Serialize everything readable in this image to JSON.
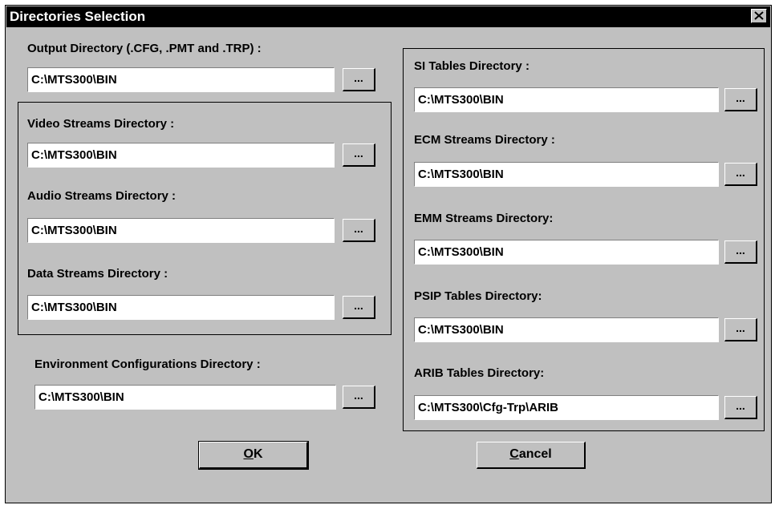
{
  "window": {
    "title": "Directories Selection",
    "close_glyph": "x-icon"
  },
  "browse_label": "...",
  "output": {
    "label": "Output Directory (.CFG, .PMT and .TRP) :",
    "value": "C:\\MTS300\\BIN"
  },
  "video": {
    "label": "Video Streams Directory :",
    "value": "C:\\MTS300\\BIN"
  },
  "audio": {
    "label": "Audio Streams Directory :",
    "value": "C:\\MTS300\\BIN"
  },
  "data_streams": {
    "label": "Data Streams Directory :",
    "value": "C:\\MTS300\\BIN"
  },
  "env": {
    "label": "Environment Configurations Directory :",
    "value": "C:\\MTS300\\BIN"
  },
  "si": {
    "label": "SI Tables Directory :",
    "value": "C:\\MTS300\\BIN"
  },
  "ecm": {
    "label": "ECM Streams Directory :",
    "value": "C:\\MTS300\\BIN"
  },
  "emm": {
    "label": "EMM Streams Directory:",
    "value": "C:\\MTS300\\BIN"
  },
  "psip": {
    "label": "PSIP Tables Directory:",
    "value": "C:\\MTS300\\BIN"
  },
  "arib": {
    "label": "ARIB Tables Directory:",
    "value": "C:\\MTS300\\Cfg-Trp\\ARIB"
  },
  "buttons": {
    "ok_mnemonic": "O",
    "ok_rest": "K",
    "cancel_mnemonic": "C",
    "cancel_rest": "ancel"
  }
}
